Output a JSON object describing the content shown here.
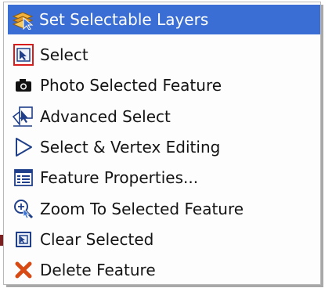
{
  "menu": {
    "items": [
      {
        "label": "Set Selectable Layers",
        "icon": "layers-icon",
        "highlighted": true
      },
      {
        "label": "Select",
        "icon": "select-arrow-icon"
      },
      {
        "label": "Photo Selected Feature",
        "icon": "camera-icon"
      },
      {
        "label": "Advanced Select",
        "icon": "advanced-select-icon"
      },
      {
        "label": "Select & Vertex Editing",
        "icon": "vertex-edit-icon"
      },
      {
        "label": "Feature Properties...",
        "icon": "properties-icon"
      },
      {
        "label": "Zoom To Selected Feature",
        "icon": "zoom-icon"
      },
      {
        "label": "Clear Selected",
        "icon": "clear-icon"
      },
      {
        "label": "Delete Feature",
        "icon": "delete-icon"
      }
    ]
  },
  "colors": {
    "highlight": "#3b6ed5",
    "select_box": "#d81c1c",
    "delete_x": "#d84a14"
  }
}
